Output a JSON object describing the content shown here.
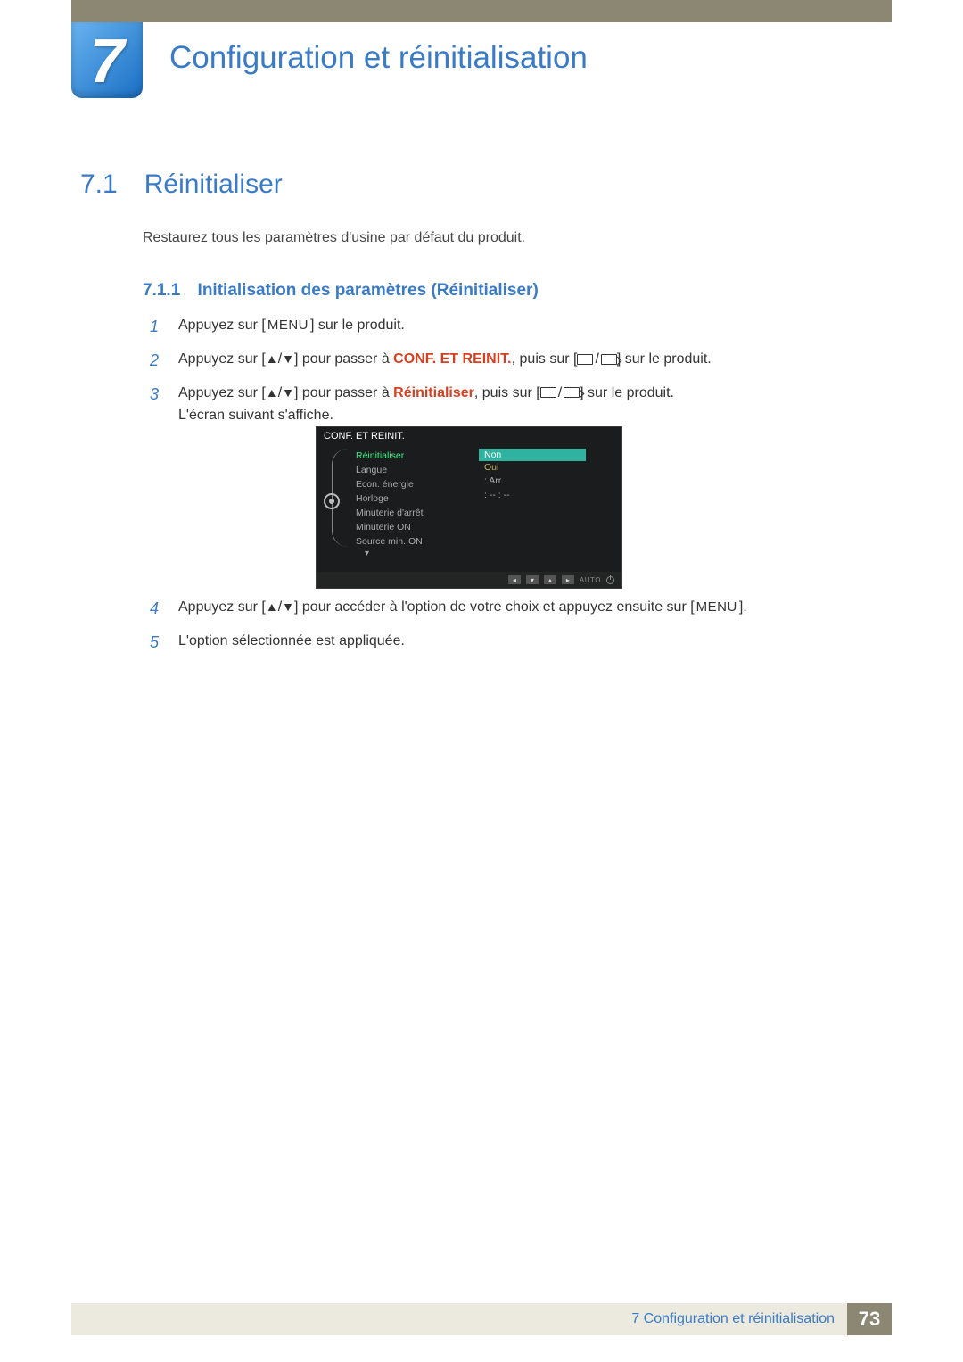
{
  "chapter": {
    "number": "7",
    "title": "Configuration et réinitialisation"
  },
  "section": {
    "number": "7.1",
    "title": "Réinitialiser"
  },
  "intro": "Restaurez tous les paramètres d'usine par défaut du produit.",
  "subsection": {
    "number": "7.1.1",
    "title": "Initialisation des paramètres (Réinitialiser)"
  },
  "keys": {
    "menu": "MENU"
  },
  "steps_a": [
    {
      "n": "1",
      "pre": "Appuyez sur [",
      "mid": "",
      "post": "] sur le produit."
    },
    {
      "n": "2",
      "pre": "Appuyez sur [",
      "mid": "] pour passer à ",
      "hl": "CONF. ET REINIT.",
      "post2": ", puis sur [",
      "post3": "] sur le produit."
    },
    {
      "n": "3",
      "pre": "Appuyez sur [",
      "mid": "] pour passer à ",
      "hl": "Réinitialiser",
      "post2": ", puis sur [",
      "post3": "] sur le produit.",
      "extra": "L'écran suivant s'affiche."
    }
  ],
  "steps_b": [
    {
      "n": "4",
      "pre": "Appuyez sur [",
      "mid": "] pour accéder à l'option de votre choix et appuyez ensuite sur [",
      "post": "]."
    },
    {
      "n": "5",
      "text": "L'option sélectionnée est appliquée."
    }
  ],
  "osd": {
    "title": "CONF. ET REINIT.",
    "items": [
      "Réinitialiser",
      "Langue",
      "Econ. énergie",
      "Horloge",
      "Minuterie d'arrêt",
      "Minuterie ON",
      "Source min. ON"
    ],
    "options": [
      "Non",
      "Oui"
    ],
    "values": {
      "econ": ": Arr.",
      "horloge": ":  -- : --"
    },
    "footer_auto": "AUTO"
  },
  "footer": {
    "label": "7 Configuration et réinitialisation",
    "page": "73"
  }
}
